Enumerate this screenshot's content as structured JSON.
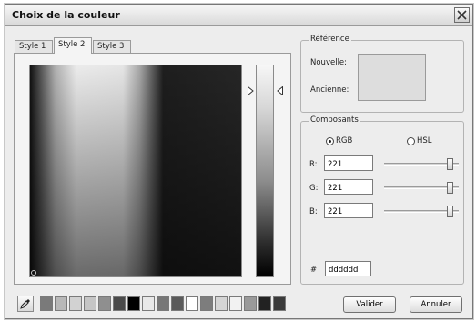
{
  "window": {
    "title": "Choix de la couleur"
  },
  "tabs": [
    {
      "label": "Style 1"
    },
    {
      "label": "Style 2"
    },
    {
      "label": "Style 3"
    }
  ],
  "reference": {
    "legend": "Référence",
    "new_label": "Nouvelle:",
    "old_label": "Ancienne:",
    "preview_color": "#dddddd"
  },
  "components": {
    "legend": "Composants",
    "mode_rgb": "RGB",
    "mode_hsl": "HSL",
    "selected_mode": "RGB",
    "r_label": "R:",
    "g_label": "G:",
    "b_label": "B:",
    "r_value": "221",
    "g_value": "221",
    "b_value": "221",
    "hex_label": "#",
    "hex_value": "dddddd"
  },
  "buttons": {
    "ok": "Valider",
    "cancel": "Annuler"
  },
  "swatches": [
    "#7a7a7a",
    "#b8b8b8",
    "#d2d2d2",
    "#c5c5c5",
    "#8f8f8f",
    "#4a4a4a",
    "#000000",
    "#e8e8e8",
    "#777777",
    "#5a5a5a",
    "#ffffff",
    "#7d7d7d",
    "#d5d5d5",
    "#f2f2f2",
    "#9a9a9a",
    "#222222",
    "#3a3a3a"
  ],
  "icons": {
    "close": "close-icon",
    "eyedropper": "eyedropper-icon"
  }
}
